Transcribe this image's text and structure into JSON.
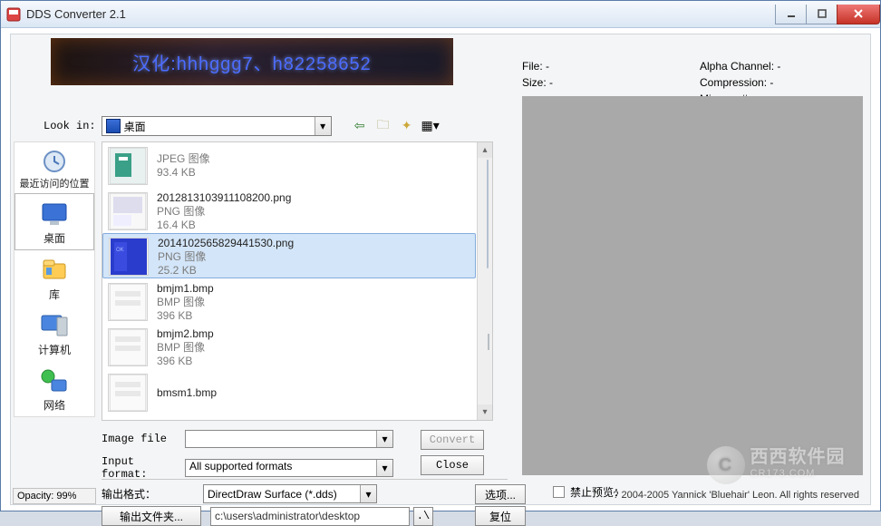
{
  "window": {
    "title": "DDS Converter 2.1"
  },
  "banner": {
    "text": "汉化:hhhggg7、h82258652"
  },
  "lookin": {
    "label": "Look in:",
    "value": "桌面"
  },
  "sidebar": {
    "items": [
      {
        "label": "最近访问的位置"
      },
      {
        "label": "桌面"
      },
      {
        "label": "库"
      },
      {
        "label": "计算机"
      },
      {
        "label": "网络"
      }
    ]
  },
  "files": [
    {
      "name": "",
      "type": "JPEG 图像",
      "size": "93.4 KB",
      "selected": false,
      "thumb": "jpeg"
    },
    {
      "name": "2012813103911108200.png",
      "type": "PNG 图像",
      "size": "16.4 KB",
      "selected": false,
      "thumb": "png1"
    },
    {
      "name": "2014102565829441530.png",
      "type": "PNG 图像",
      "size": "25.2 KB",
      "selected": true,
      "thumb": "png2"
    },
    {
      "name": "bmjm1.bmp",
      "type": "BMP 图像",
      "size": "396 KB",
      "selected": false,
      "thumb": "bmp"
    },
    {
      "name": "bmjm2.bmp",
      "type": "BMP 图像",
      "size": "396 KB",
      "selected": false,
      "thumb": "bmp"
    },
    {
      "name": "bmsm1.bmp",
      "type": "",
      "size": "",
      "selected": false,
      "thumb": "bmp"
    }
  ],
  "form": {
    "image_file_label": "Image file",
    "image_file_value": "",
    "input_format_label": "Input format:",
    "input_format_value": "All supported formats",
    "convert": "Convert",
    "close": "Close"
  },
  "output": {
    "format_label": "输出格式：",
    "format_value": "DirectDraw Surface (*.dds)",
    "options": "选项...",
    "folder_btn": "输出文件夹...",
    "path": "c:\\users\\administrator\\desktop",
    "browse": ".\\",
    "reset": "复位"
  },
  "info": {
    "file_label": "File:",
    "file_value": "-",
    "size_label": "Size:",
    "size_value": "-",
    "alpha_label": "Alpha Channel:",
    "alpha_value": "-",
    "comp_label": "Compression:",
    "comp_value": "-",
    "mip_label": "Mipmap #:",
    "mip_value": "-"
  },
  "disable_preview": {
    "label": "禁止预览：",
    "checked": false
  },
  "watermark": {
    "text": "西西软件园",
    "url": "CR173.COM"
  },
  "copyright": "? 2004-2005 Yannick 'Bluehair' Leon. All rights reserved",
  "opacity": "Opacity: 99%"
}
